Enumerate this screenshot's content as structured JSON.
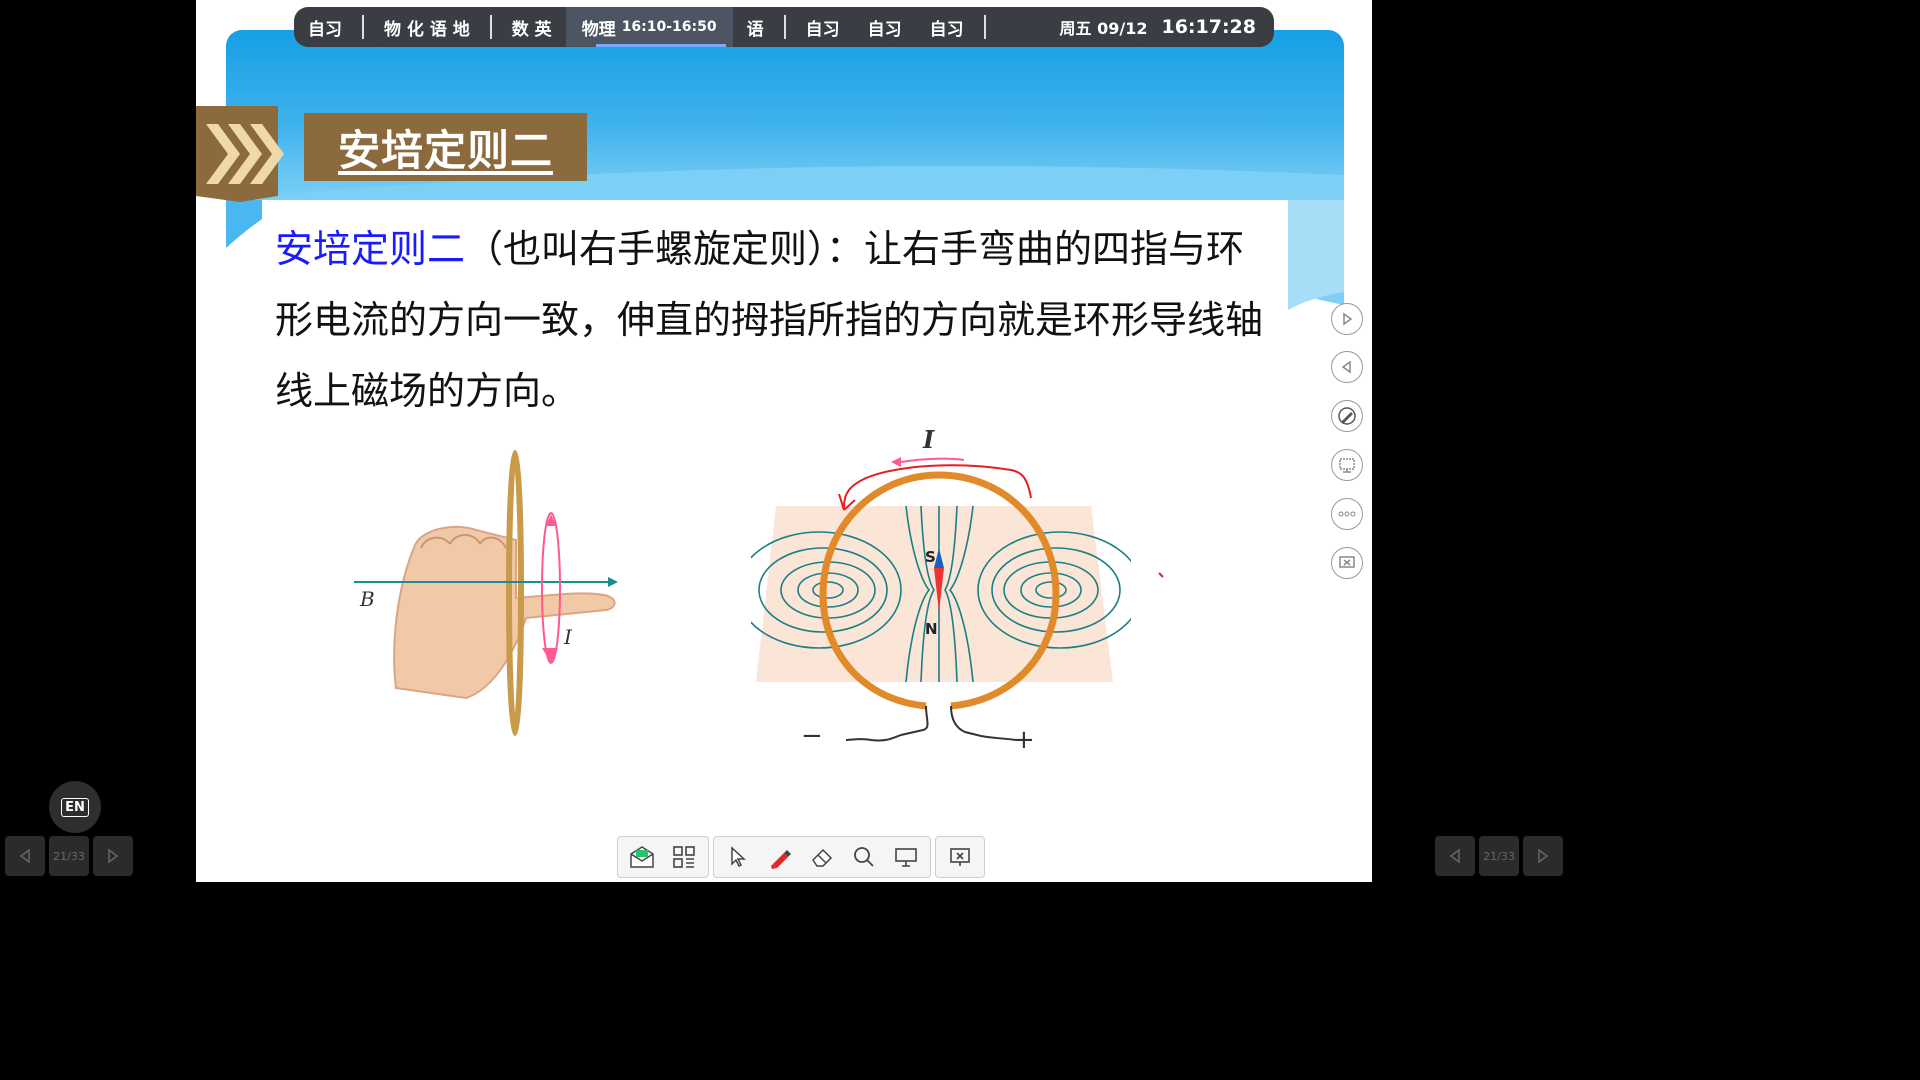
{
  "schedule": {
    "items": [
      "自习",
      "物 化 语 地",
      "数 英",
      "语",
      "自习",
      "自习",
      "自习"
    ],
    "current_subject": "物理",
    "current_time": "16:10-16:50",
    "day": "周五 09/12",
    "clock": "16:17:28"
  },
  "slide": {
    "title": "安培定则二",
    "para_blue": "安培定则二",
    "para_rest": "（也叫右手螺旋定则）：让右手弯曲的四指与环形电流的方向一致，伸直的拇指所指的方向就是环形导线轴线上磁场的方向。",
    "fig1": {
      "label_b": "B",
      "label_i": "I"
    },
    "fig2": {
      "label_i": "I",
      "label_s": "S",
      "label_n": "N",
      "label_minus": "−",
      "label_plus": "+"
    }
  },
  "nav": {
    "page_left": "21/33",
    "page_right": "21/33"
  },
  "en_button": "EN",
  "colors": {
    "banner": "#159fe6",
    "title_box": "#8b6a3e",
    "para_highlight": "#1a1aff",
    "coil": "#e08a2a",
    "field_lines": "#1a7f86",
    "current_arrow": "#ff4d88"
  }
}
